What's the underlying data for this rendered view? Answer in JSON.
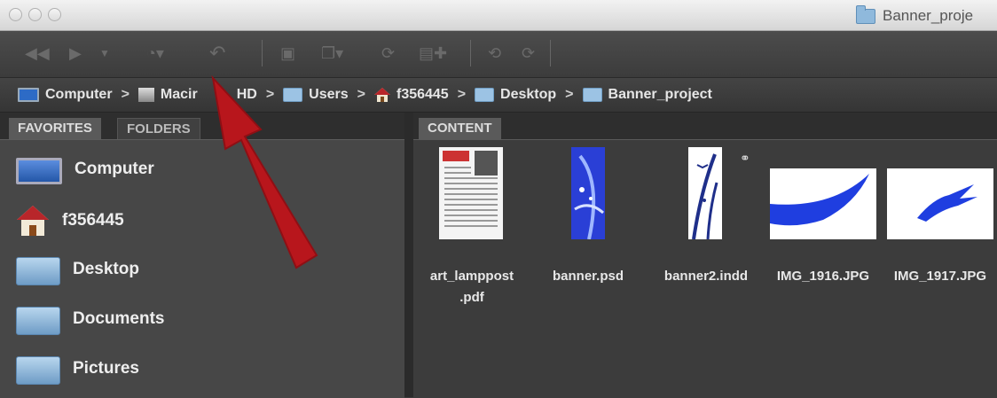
{
  "window": {
    "title": "Banner_proje"
  },
  "path_bar": {
    "crumbs": [
      {
        "label": "Computer",
        "icon": "computer-icon"
      },
      {
        "label": "Macir",
        "icon": "hard-drive-icon"
      },
      {
        "label": "HD",
        "icon": "none"
      },
      {
        "label": "Users",
        "icon": "folder-icon"
      },
      {
        "label": "f356445",
        "icon": "home-icon"
      },
      {
        "label": "Desktop",
        "icon": "folder-icon"
      },
      {
        "label": "Banner_project",
        "icon": "folder-icon"
      }
    ],
    "separator": ">"
  },
  "left_panel": {
    "tabs": [
      {
        "label": "FAVORITES",
        "active": true
      },
      {
        "label": "FOLDERS",
        "active": false
      }
    ],
    "favorites": [
      {
        "label": "Computer",
        "icon": "computer-icon"
      },
      {
        "label": "f356445",
        "icon": "home-icon"
      },
      {
        "label": "Desktop",
        "icon": "folder-icon"
      },
      {
        "label": "Documents",
        "icon": "folder-icon"
      },
      {
        "label": "Pictures",
        "icon": "folder-icon"
      }
    ]
  },
  "content_panel": {
    "tab_label": "CONTENT",
    "items": [
      {
        "name_line1": "art_lamppost",
        "name_line2": ".pdf",
        "type": "pdf-document-thumbnail"
      },
      {
        "name_line1": "banner.psd",
        "name_line2": "",
        "type": "blue-banner-thumbnail"
      },
      {
        "name_line1": "banner2.indd",
        "name_line2": "",
        "type": "white-banner-thumbnail"
      },
      {
        "name_line1": "IMG_1916.JPG",
        "name_line2": "",
        "type": "blue-swoosh-thumbnail"
      },
      {
        "name_line1": "IMG_1917.JPG",
        "name_line2": "",
        "type": "blue-bird-thumbnail"
      }
    ]
  },
  "toolbar": {
    "icons": [
      "back-icon",
      "forward-icon",
      "dropdown-icon",
      "recent-icon",
      "return-icon",
      "camera-icon",
      "copy-icon",
      "refresh-icon",
      "new-file-icon",
      "rotate-left-icon",
      "rotate-right-icon"
    ]
  },
  "colors": {
    "annotation_arrow": "#b8161c",
    "panel_bg": "#474747",
    "content_bg": "#3c3c3c"
  }
}
